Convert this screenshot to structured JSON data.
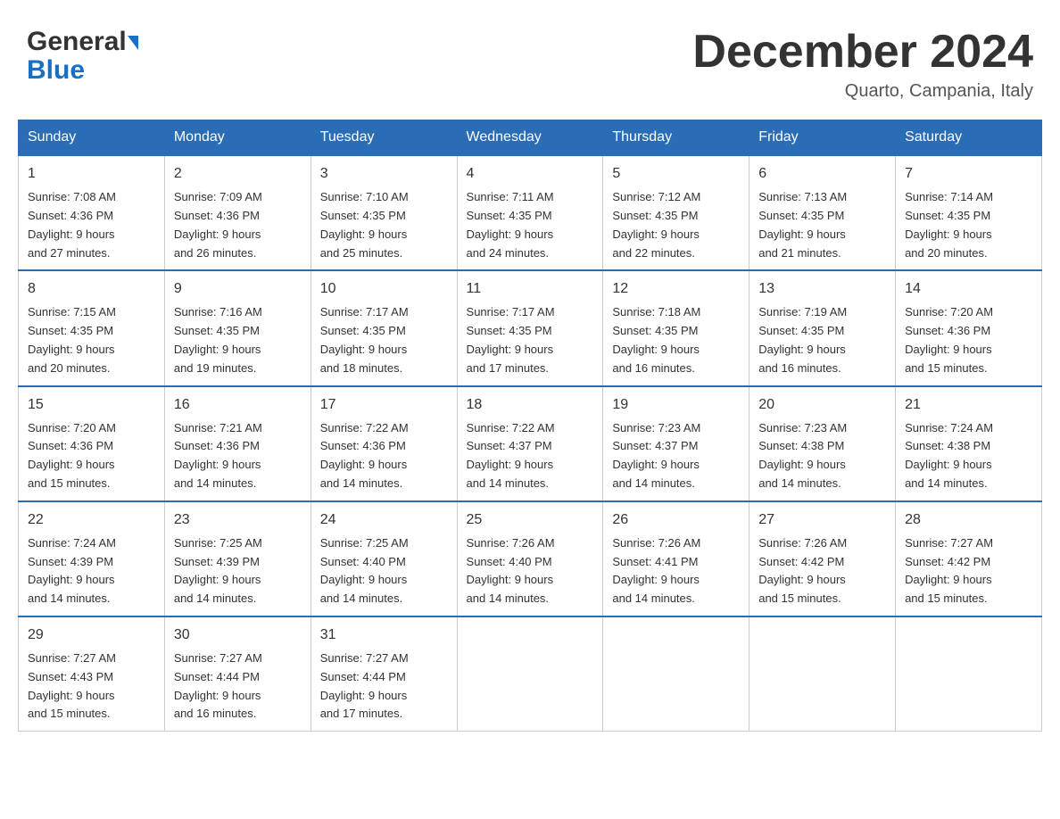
{
  "header": {
    "month_title": "December 2024",
    "location": "Quarto, Campania, Italy",
    "logo_general": "General",
    "logo_blue": "Blue"
  },
  "days_of_week": [
    "Sunday",
    "Monday",
    "Tuesday",
    "Wednesday",
    "Thursday",
    "Friday",
    "Saturday"
  ],
  "weeks": [
    [
      {
        "day": "1",
        "sunrise": "7:08 AM",
        "sunset": "4:36 PM",
        "daylight": "9 hours and 27 minutes."
      },
      {
        "day": "2",
        "sunrise": "7:09 AM",
        "sunset": "4:36 PM",
        "daylight": "9 hours and 26 minutes."
      },
      {
        "day": "3",
        "sunrise": "7:10 AM",
        "sunset": "4:35 PM",
        "daylight": "9 hours and 25 minutes."
      },
      {
        "day": "4",
        "sunrise": "7:11 AM",
        "sunset": "4:35 PM",
        "daylight": "9 hours and 24 minutes."
      },
      {
        "day": "5",
        "sunrise": "7:12 AM",
        "sunset": "4:35 PM",
        "daylight": "9 hours and 22 minutes."
      },
      {
        "day": "6",
        "sunrise": "7:13 AM",
        "sunset": "4:35 PM",
        "daylight": "9 hours and 21 minutes."
      },
      {
        "day": "7",
        "sunrise": "7:14 AM",
        "sunset": "4:35 PM",
        "daylight": "9 hours and 20 minutes."
      }
    ],
    [
      {
        "day": "8",
        "sunrise": "7:15 AM",
        "sunset": "4:35 PM",
        "daylight": "9 hours and 20 minutes."
      },
      {
        "day": "9",
        "sunrise": "7:16 AM",
        "sunset": "4:35 PM",
        "daylight": "9 hours and 19 minutes."
      },
      {
        "day": "10",
        "sunrise": "7:17 AM",
        "sunset": "4:35 PM",
        "daylight": "9 hours and 18 minutes."
      },
      {
        "day": "11",
        "sunrise": "7:17 AM",
        "sunset": "4:35 PM",
        "daylight": "9 hours and 17 minutes."
      },
      {
        "day": "12",
        "sunrise": "7:18 AM",
        "sunset": "4:35 PM",
        "daylight": "9 hours and 16 minutes."
      },
      {
        "day": "13",
        "sunrise": "7:19 AM",
        "sunset": "4:35 PM",
        "daylight": "9 hours and 16 minutes."
      },
      {
        "day": "14",
        "sunrise": "7:20 AM",
        "sunset": "4:36 PM",
        "daylight": "9 hours and 15 minutes."
      }
    ],
    [
      {
        "day": "15",
        "sunrise": "7:20 AM",
        "sunset": "4:36 PM",
        "daylight": "9 hours and 15 minutes."
      },
      {
        "day": "16",
        "sunrise": "7:21 AM",
        "sunset": "4:36 PM",
        "daylight": "9 hours and 14 minutes."
      },
      {
        "day": "17",
        "sunrise": "7:22 AM",
        "sunset": "4:36 PM",
        "daylight": "9 hours and 14 minutes."
      },
      {
        "day": "18",
        "sunrise": "7:22 AM",
        "sunset": "4:37 PM",
        "daylight": "9 hours and 14 minutes."
      },
      {
        "day": "19",
        "sunrise": "7:23 AM",
        "sunset": "4:37 PM",
        "daylight": "9 hours and 14 minutes."
      },
      {
        "day": "20",
        "sunrise": "7:23 AM",
        "sunset": "4:38 PM",
        "daylight": "9 hours and 14 minutes."
      },
      {
        "day": "21",
        "sunrise": "7:24 AM",
        "sunset": "4:38 PM",
        "daylight": "9 hours and 14 minutes."
      }
    ],
    [
      {
        "day": "22",
        "sunrise": "7:24 AM",
        "sunset": "4:39 PM",
        "daylight": "9 hours and 14 minutes."
      },
      {
        "day": "23",
        "sunrise": "7:25 AM",
        "sunset": "4:39 PM",
        "daylight": "9 hours and 14 minutes."
      },
      {
        "day": "24",
        "sunrise": "7:25 AM",
        "sunset": "4:40 PM",
        "daylight": "9 hours and 14 minutes."
      },
      {
        "day": "25",
        "sunrise": "7:26 AM",
        "sunset": "4:40 PM",
        "daylight": "9 hours and 14 minutes."
      },
      {
        "day": "26",
        "sunrise": "7:26 AM",
        "sunset": "4:41 PM",
        "daylight": "9 hours and 14 minutes."
      },
      {
        "day": "27",
        "sunrise": "7:26 AM",
        "sunset": "4:42 PM",
        "daylight": "9 hours and 15 minutes."
      },
      {
        "day": "28",
        "sunrise": "7:27 AM",
        "sunset": "4:42 PM",
        "daylight": "9 hours and 15 minutes."
      }
    ],
    [
      {
        "day": "29",
        "sunrise": "7:27 AM",
        "sunset": "4:43 PM",
        "daylight": "9 hours and 15 minutes."
      },
      {
        "day": "30",
        "sunrise": "7:27 AM",
        "sunset": "4:44 PM",
        "daylight": "9 hours and 16 minutes."
      },
      {
        "day": "31",
        "sunrise": "7:27 AM",
        "sunset": "4:44 PM",
        "daylight": "9 hours and 17 minutes."
      },
      null,
      null,
      null,
      null
    ]
  ],
  "labels": {
    "sunrise": "Sunrise:",
    "sunset": "Sunset:",
    "daylight": "Daylight:"
  }
}
